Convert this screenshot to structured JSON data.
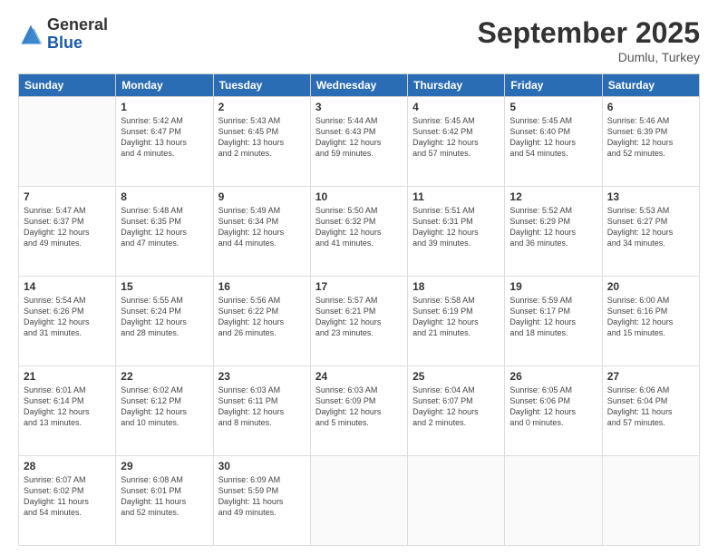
{
  "logo": {
    "general": "General",
    "blue": "Blue"
  },
  "title": "September 2025",
  "location": "Dumlu, Turkey",
  "headers": [
    "Sunday",
    "Monday",
    "Tuesday",
    "Wednesday",
    "Thursday",
    "Friday",
    "Saturday"
  ],
  "weeks": [
    [
      {
        "day": "",
        "info": ""
      },
      {
        "day": "1",
        "info": "Sunrise: 5:42 AM\nSunset: 6:47 PM\nDaylight: 13 hours\nand 4 minutes."
      },
      {
        "day": "2",
        "info": "Sunrise: 5:43 AM\nSunset: 6:45 PM\nDaylight: 13 hours\nand 2 minutes."
      },
      {
        "day": "3",
        "info": "Sunrise: 5:44 AM\nSunset: 6:43 PM\nDaylight: 12 hours\nand 59 minutes."
      },
      {
        "day": "4",
        "info": "Sunrise: 5:45 AM\nSunset: 6:42 PM\nDaylight: 12 hours\nand 57 minutes."
      },
      {
        "day": "5",
        "info": "Sunrise: 5:45 AM\nSunset: 6:40 PM\nDaylight: 12 hours\nand 54 minutes."
      },
      {
        "day": "6",
        "info": "Sunrise: 5:46 AM\nSunset: 6:39 PM\nDaylight: 12 hours\nand 52 minutes."
      }
    ],
    [
      {
        "day": "7",
        "info": "Sunrise: 5:47 AM\nSunset: 6:37 PM\nDaylight: 12 hours\nand 49 minutes."
      },
      {
        "day": "8",
        "info": "Sunrise: 5:48 AM\nSunset: 6:35 PM\nDaylight: 12 hours\nand 47 minutes."
      },
      {
        "day": "9",
        "info": "Sunrise: 5:49 AM\nSunset: 6:34 PM\nDaylight: 12 hours\nand 44 minutes."
      },
      {
        "day": "10",
        "info": "Sunrise: 5:50 AM\nSunset: 6:32 PM\nDaylight: 12 hours\nand 41 minutes."
      },
      {
        "day": "11",
        "info": "Sunrise: 5:51 AM\nSunset: 6:31 PM\nDaylight: 12 hours\nand 39 minutes."
      },
      {
        "day": "12",
        "info": "Sunrise: 5:52 AM\nSunset: 6:29 PM\nDaylight: 12 hours\nand 36 minutes."
      },
      {
        "day": "13",
        "info": "Sunrise: 5:53 AM\nSunset: 6:27 PM\nDaylight: 12 hours\nand 34 minutes."
      }
    ],
    [
      {
        "day": "14",
        "info": "Sunrise: 5:54 AM\nSunset: 6:26 PM\nDaylight: 12 hours\nand 31 minutes."
      },
      {
        "day": "15",
        "info": "Sunrise: 5:55 AM\nSunset: 6:24 PM\nDaylight: 12 hours\nand 28 minutes."
      },
      {
        "day": "16",
        "info": "Sunrise: 5:56 AM\nSunset: 6:22 PM\nDaylight: 12 hours\nand 26 minutes."
      },
      {
        "day": "17",
        "info": "Sunrise: 5:57 AM\nSunset: 6:21 PM\nDaylight: 12 hours\nand 23 minutes."
      },
      {
        "day": "18",
        "info": "Sunrise: 5:58 AM\nSunset: 6:19 PM\nDaylight: 12 hours\nand 21 minutes."
      },
      {
        "day": "19",
        "info": "Sunrise: 5:59 AM\nSunset: 6:17 PM\nDaylight: 12 hours\nand 18 minutes."
      },
      {
        "day": "20",
        "info": "Sunrise: 6:00 AM\nSunset: 6:16 PM\nDaylight: 12 hours\nand 15 minutes."
      }
    ],
    [
      {
        "day": "21",
        "info": "Sunrise: 6:01 AM\nSunset: 6:14 PM\nDaylight: 12 hours\nand 13 minutes."
      },
      {
        "day": "22",
        "info": "Sunrise: 6:02 AM\nSunset: 6:12 PM\nDaylight: 12 hours\nand 10 minutes."
      },
      {
        "day": "23",
        "info": "Sunrise: 6:03 AM\nSunset: 6:11 PM\nDaylight: 12 hours\nand 8 minutes."
      },
      {
        "day": "24",
        "info": "Sunrise: 6:03 AM\nSunset: 6:09 PM\nDaylight: 12 hours\nand 5 minutes."
      },
      {
        "day": "25",
        "info": "Sunrise: 6:04 AM\nSunset: 6:07 PM\nDaylight: 12 hours\nand 2 minutes."
      },
      {
        "day": "26",
        "info": "Sunrise: 6:05 AM\nSunset: 6:06 PM\nDaylight: 12 hours\nand 0 minutes."
      },
      {
        "day": "27",
        "info": "Sunrise: 6:06 AM\nSunset: 6:04 PM\nDaylight: 11 hours\nand 57 minutes."
      }
    ],
    [
      {
        "day": "28",
        "info": "Sunrise: 6:07 AM\nSunset: 6:02 PM\nDaylight: 11 hours\nand 54 minutes."
      },
      {
        "day": "29",
        "info": "Sunrise: 6:08 AM\nSunset: 6:01 PM\nDaylight: 11 hours\nand 52 minutes."
      },
      {
        "day": "30",
        "info": "Sunrise: 6:09 AM\nSunset: 5:59 PM\nDaylight: 11 hours\nand 49 minutes."
      },
      {
        "day": "",
        "info": ""
      },
      {
        "day": "",
        "info": ""
      },
      {
        "day": "",
        "info": ""
      },
      {
        "day": "",
        "info": ""
      }
    ]
  ]
}
